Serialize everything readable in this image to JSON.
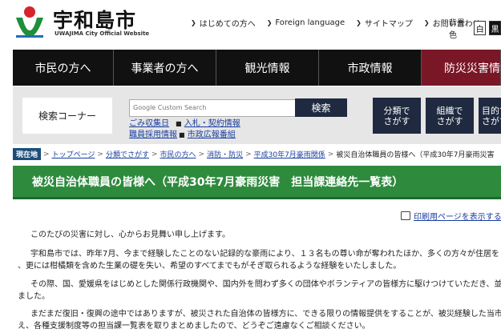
{
  "header": {
    "site_name": "宇和島市",
    "site_sub": "UWAJIMA City Official Website",
    "links": [
      "はじめての方へ",
      "Foreign language",
      "サイトマップ",
      "お問い合わせ"
    ],
    "bg_label": "背景色",
    "bg_white": "白",
    "bg_black": "黒"
  },
  "nav": [
    "市民の方へ",
    "事業者の方へ",
    "観光情報",
    "市政情報",
    "防災災害情報"
  ],
  "search": {
    "label": "検索コーナー",
    "placeholder": "Google Custom Search",
    "button": "検索",
    "quick_links": [
      "ごみ収集日",
      "入札・契約情報",
      "職員採用情報",
      "市政広報番組"
    ]
  },
  "category_buttons": [
    "分類で\nさがす",
    "組織で\nさがす",
    "目的で\nさがす"
  ],
  "breadcrumb": {
    "tag": "現在地",
    "items": [
      "トップページ",
      "分類でさがす",
      "市民の方へ",
      "消防・防災",
      "平成30年7月豪雨関係"
    ],
    "current": "被災自治体職員の皆様へ（平成30年7月豪雨災害　担"
  },
  "page_title": "被災自治体職員の皆様へ（平成30年7月豪雨災害　担当課連絡先一覧表）",
  "print_label": "印刷用ページを表示する",
  "body": [
    "このたびの災害に対し、心からお見舞い申し上げます。",
    "宇和島市では、昨年7月、今まで経験したことのない記録的な豪雨により、１３名もの尊い命が奪われたほか、多くの方々が住居を",
    "、更には柑橘類を含めた生業の礎を失い、希望のすべてまでもがそぎ取られるような経験をいたしました。",
    "その際、国、愛媛県をはじめとした関係行政機関や、国内外を問わず多くの団体やボランティアの皆様方に駆けつけていただき、並",
    "ました。",
    "まだまだ復旧・復興の途中ではありますが、被災された自治体の皆様方に、できる限りの情報提供をすることが、被災経験した当市",
    "え、各種支援制度等の担当課一覧表を取りまとめましたので、どうぞご遠慮なくご相談ください。"
  ],
  "colors": {
    "nav_bg": "#111111",
    "disaster_tab": "#7a1727",
    "title_bar": "#2e8a3d",
    "search_btn": "#1f2a40"
  }
}
